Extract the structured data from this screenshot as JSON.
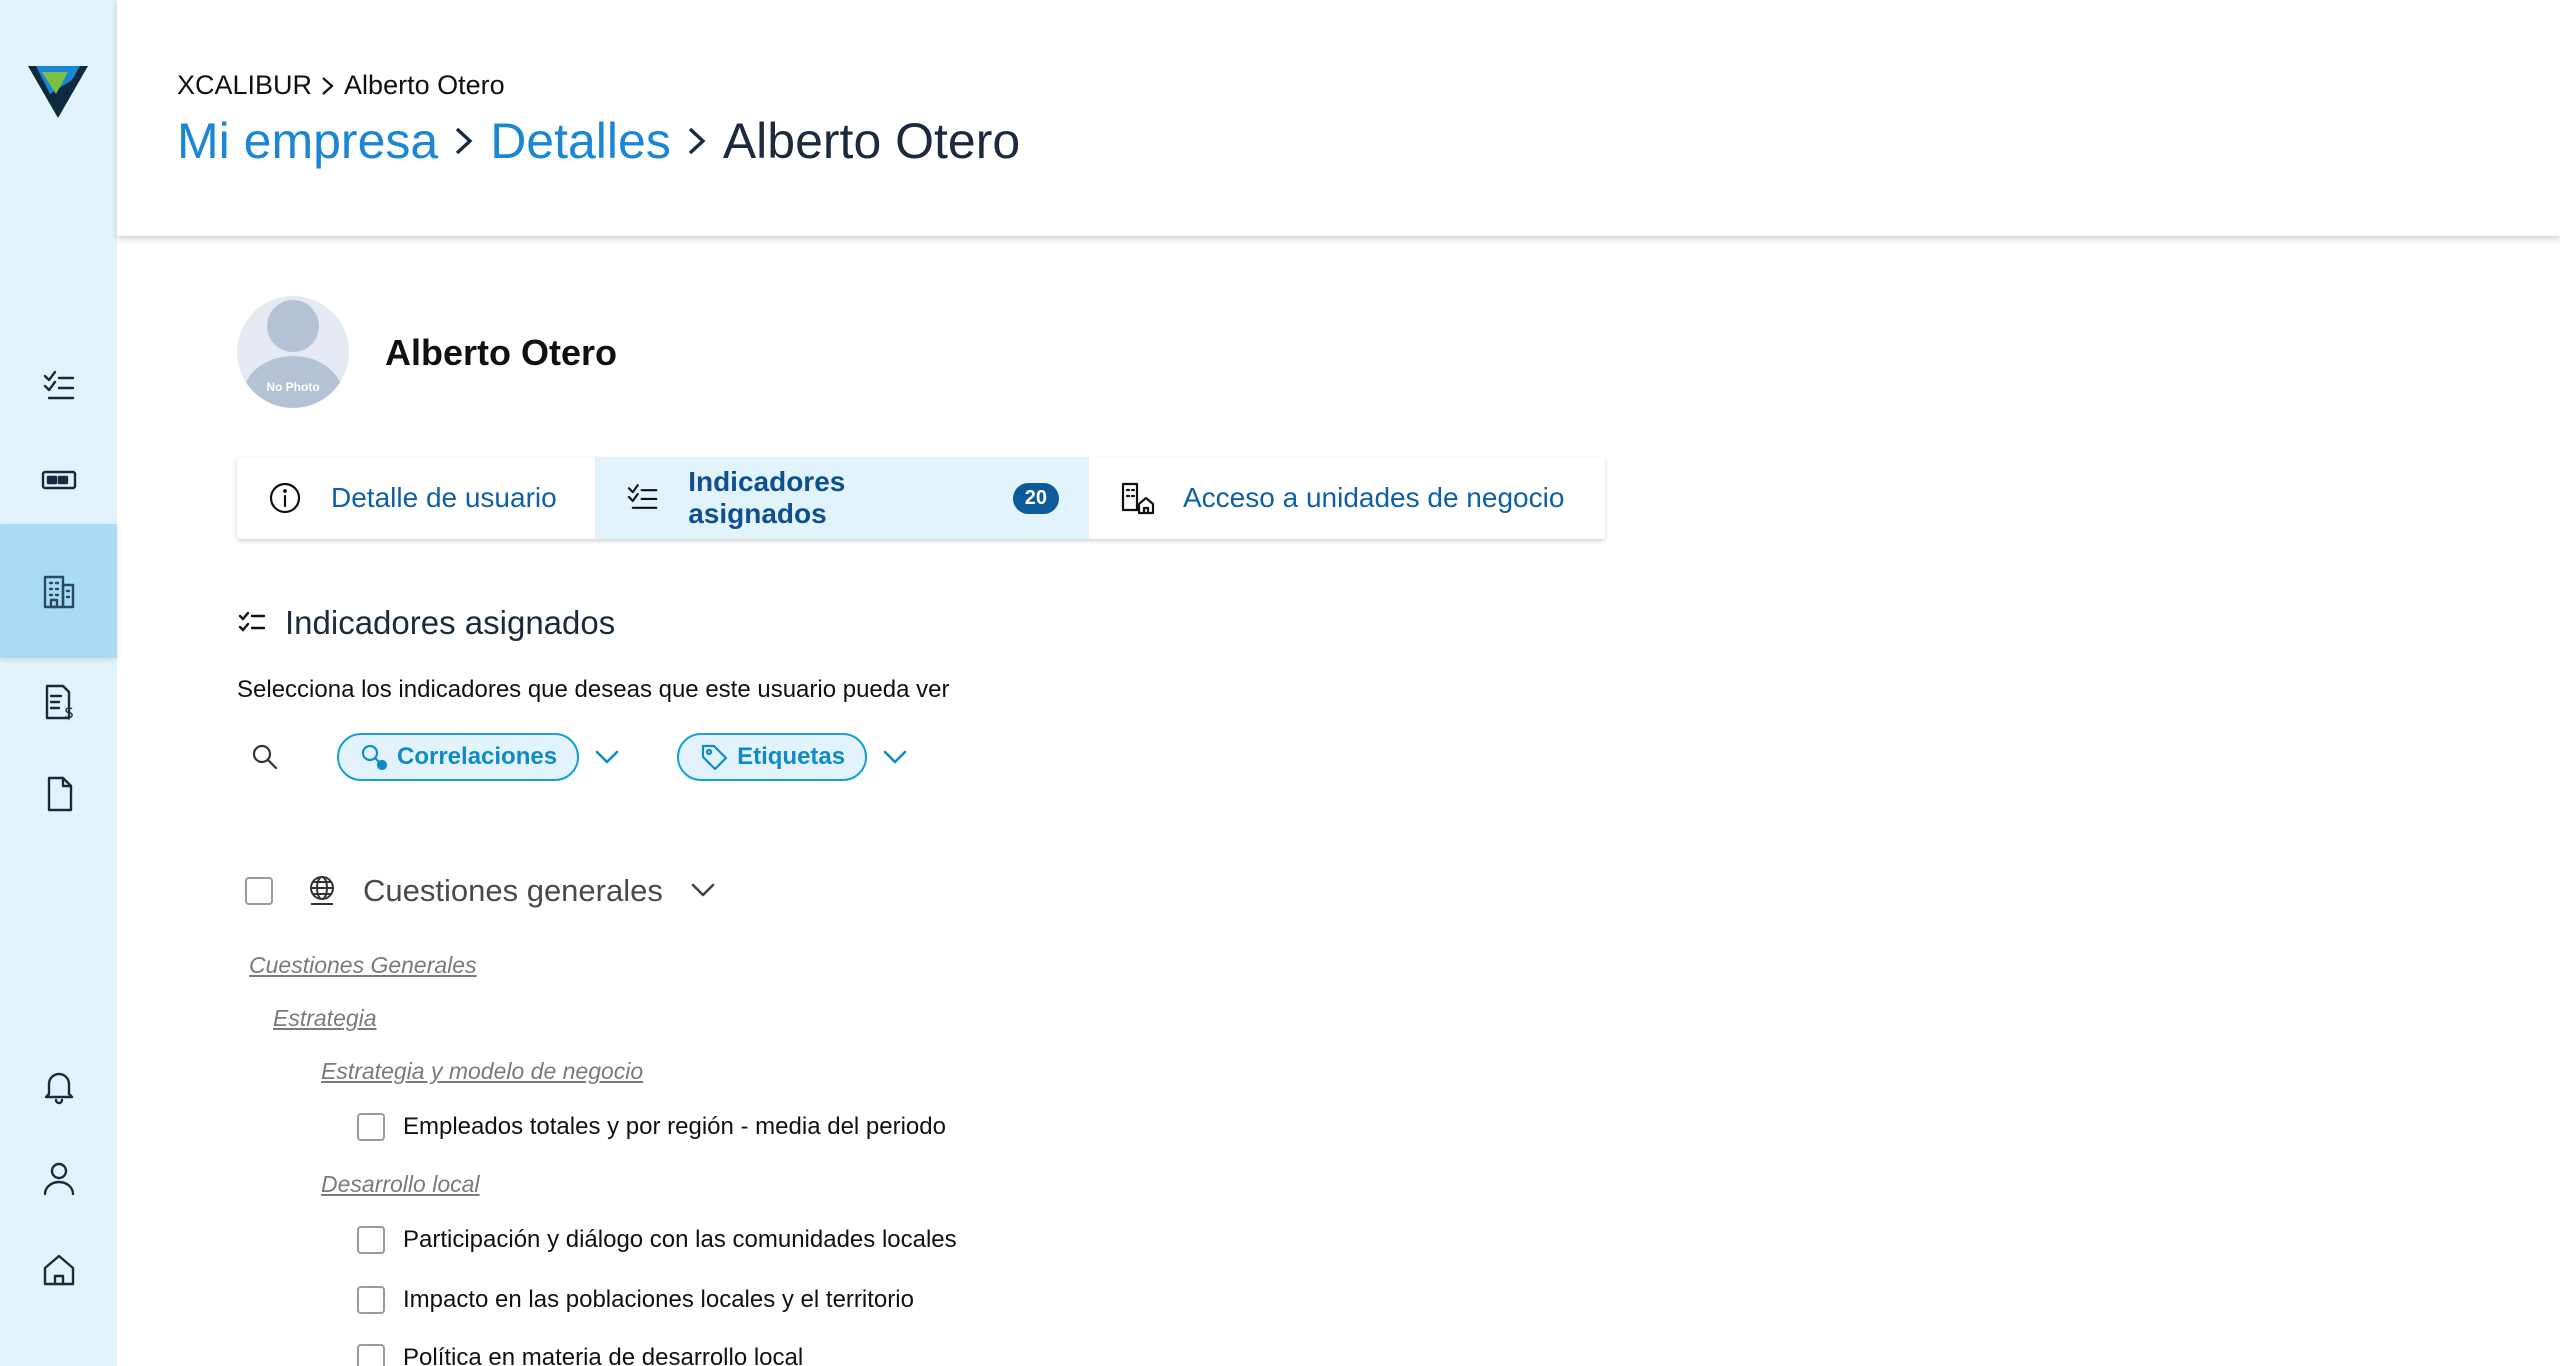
{
  "sidebar": {
    "logo": "xcalibur-logo",
    "items": [
      {
        "icon": "checklist-icon",
        "active": false
      },
      {
        "icon": "card-icon",
        "active": false
      },
      {
        "icon": "building-icon",
        "active": true
      },
      {
        "icon": "invoice-icon",
        "active": false
      },
      {
        "icon": "document-icon",
        "active": false
      },
      {
        "icon": "bell-icon",
        "active": false
      },
      {
        "icon": "user-icon",
        "active": false
      },
      {
        "icon": "home-icon",
        "active": false
      }
    ]
  },
  "header": {
    "small_crumb": [
      "XCALIBUR",
      "Alberto Otero"
    ],
    "large_crumb": [
      "Mi empresa",
      "Detalles",
      "Alberto Otero"
    ]
  },
  "profile": {
    "avatar_text": "No Photo",
    "name": "Alberto Otero"
  },
  "tabs": [
    {
      "label": "Detalle de usuario",
      "icon": "info-icon",
      "active": false
    },
    {
      "label": "Indicadores asignados",
      "icon": "checklist-icon",
      "active": true,
      "badge": "20"
    },
    {
      "label": "Acceso a unidades de negocio",
      "icon": "building-home-icon",
      "active": false
    }
  ],
  "section": {
    "title": "Indicadores asignados",
    "subtitle": "Selecciona los indicadores que deseas que este usuario pueda ver"
  },
  "filters": {
    "chips": [
      {
        "label": "Correlaciones",
        "icon": "correlation-icon"
      },
      {
        "label": "Etiquetas",
        "icon": "tag-icon"
      }
    ]
  },
  "group": {
    "label": "Cuestiones generales",
    "icon": "globe-icon"
  },
  "tree": {
    "level1": "Cuestiones Generales",
    "level2": "Estrategia",
    "level3a": "Estrategia y modelo de negocio",
    "item1": "Empleados totales y por región - media del periodo",
    "level3b": "Desarrollo local",
    "item2": "Participación y diálogo con las comunidades locales",
    "item3": "Impacto en las poblaciones locales y el territorio",
    "item4": "Política en materia de desarrollo local"
  },
  "colors": {
    "sidebar_bg": "#e3f3fb",
    "sidebar_active": "#a8dcf2",
    "link_blue": "#1a86d6",
    "chip_border": "#14a0d8",
    "badge_bg": "#0c5a9a"
  }
}
